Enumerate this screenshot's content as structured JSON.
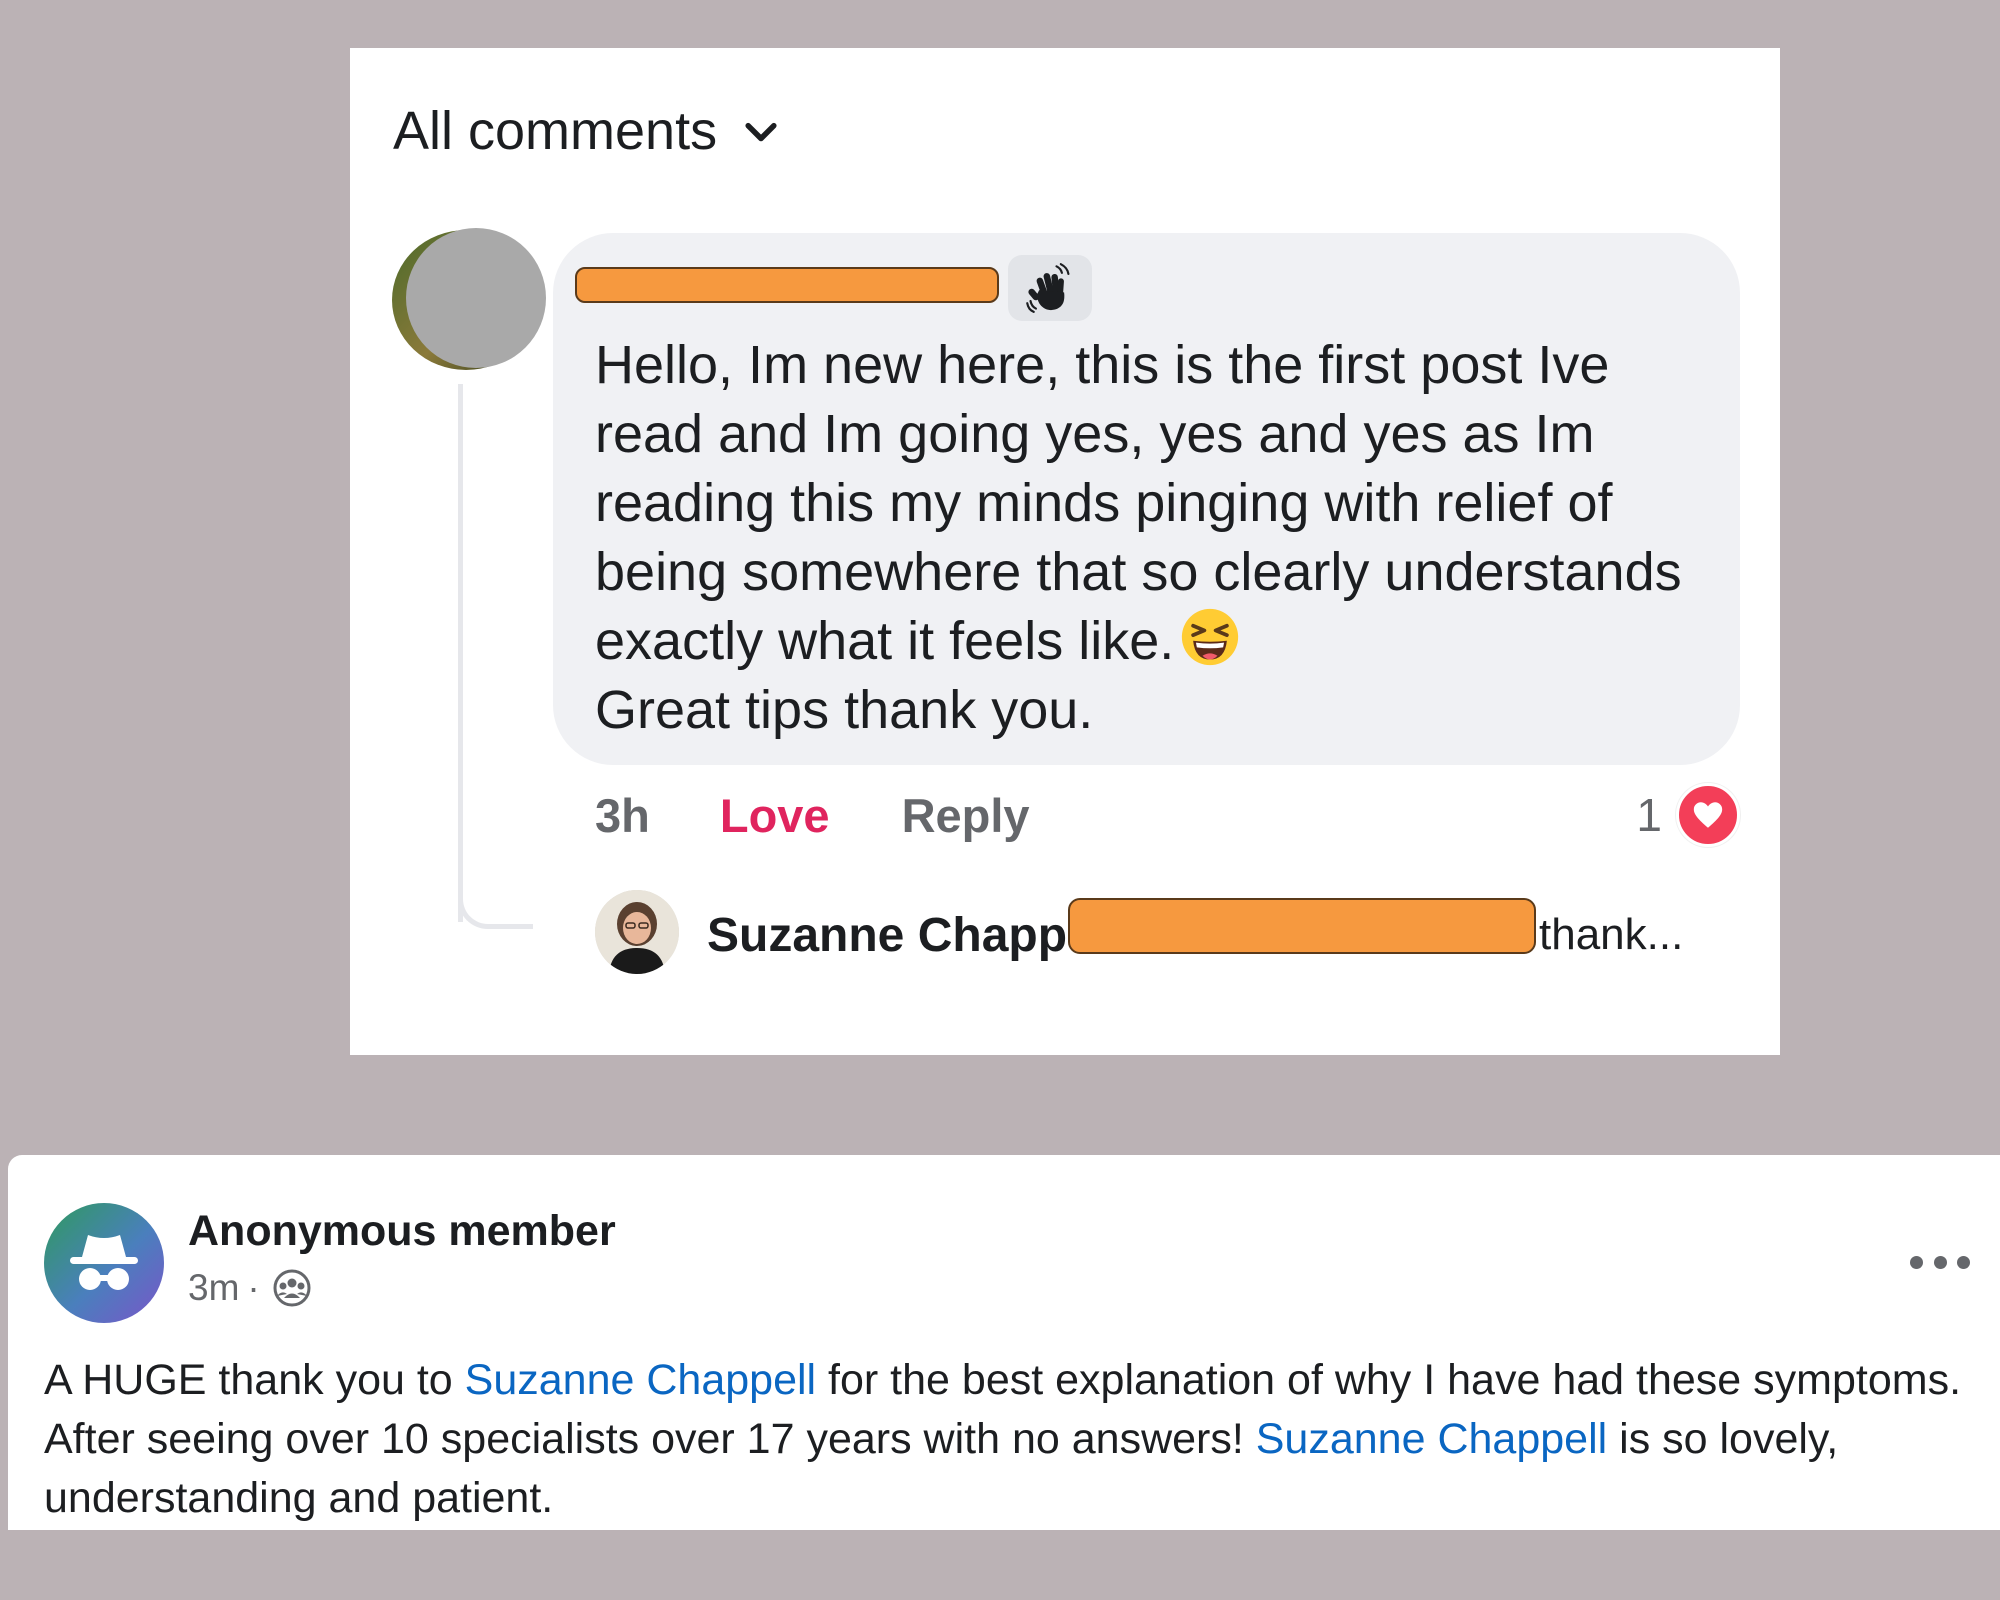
{
  "comments_panel": {
    "sort_label": "All comments",
    "comment": {
      "text_before_emoji": "Hello, Im new here, this is the first post Ive read and Im going yes, yes and yes as Im reading this my minds pinging with relief of being somewhere that so clearly understands exactly what it feels like.",
      "text_after_emoji": "Great tips thank you.",
      "time": "3h",
      "love_label": "Love",
      "reply_label": "Reply",
      "reaction_count": "1"
    },
    "reply_preview": {
      "author": "Suzanne Chappell",
      "snippet": "thank..."
    }
  },
  "post": {
    "author": "Anonymous member",
    "time": "3m",
    "separator": "·",
    "text_1": "A HUGE thank you to ",
    "mention_1": "Suzanne Chappell",
    "text_2": " for the best explanation of why I have had these symptoms. After seeing over 10 specialists over 17 years with no answers! ",
    "mention_2": "Suzanne Chappell",
    "text_3": " is so lovely, understanding and patient."
  },
  "colors": {
    "page_bg": "#bbb2b5",
    "bubble_bg": "#f0f1f4",
    "love_red": "#e0245e",
    "link_blue": "#0a66c2",
    "redaction_orange": "#f6993f"
  }
}
